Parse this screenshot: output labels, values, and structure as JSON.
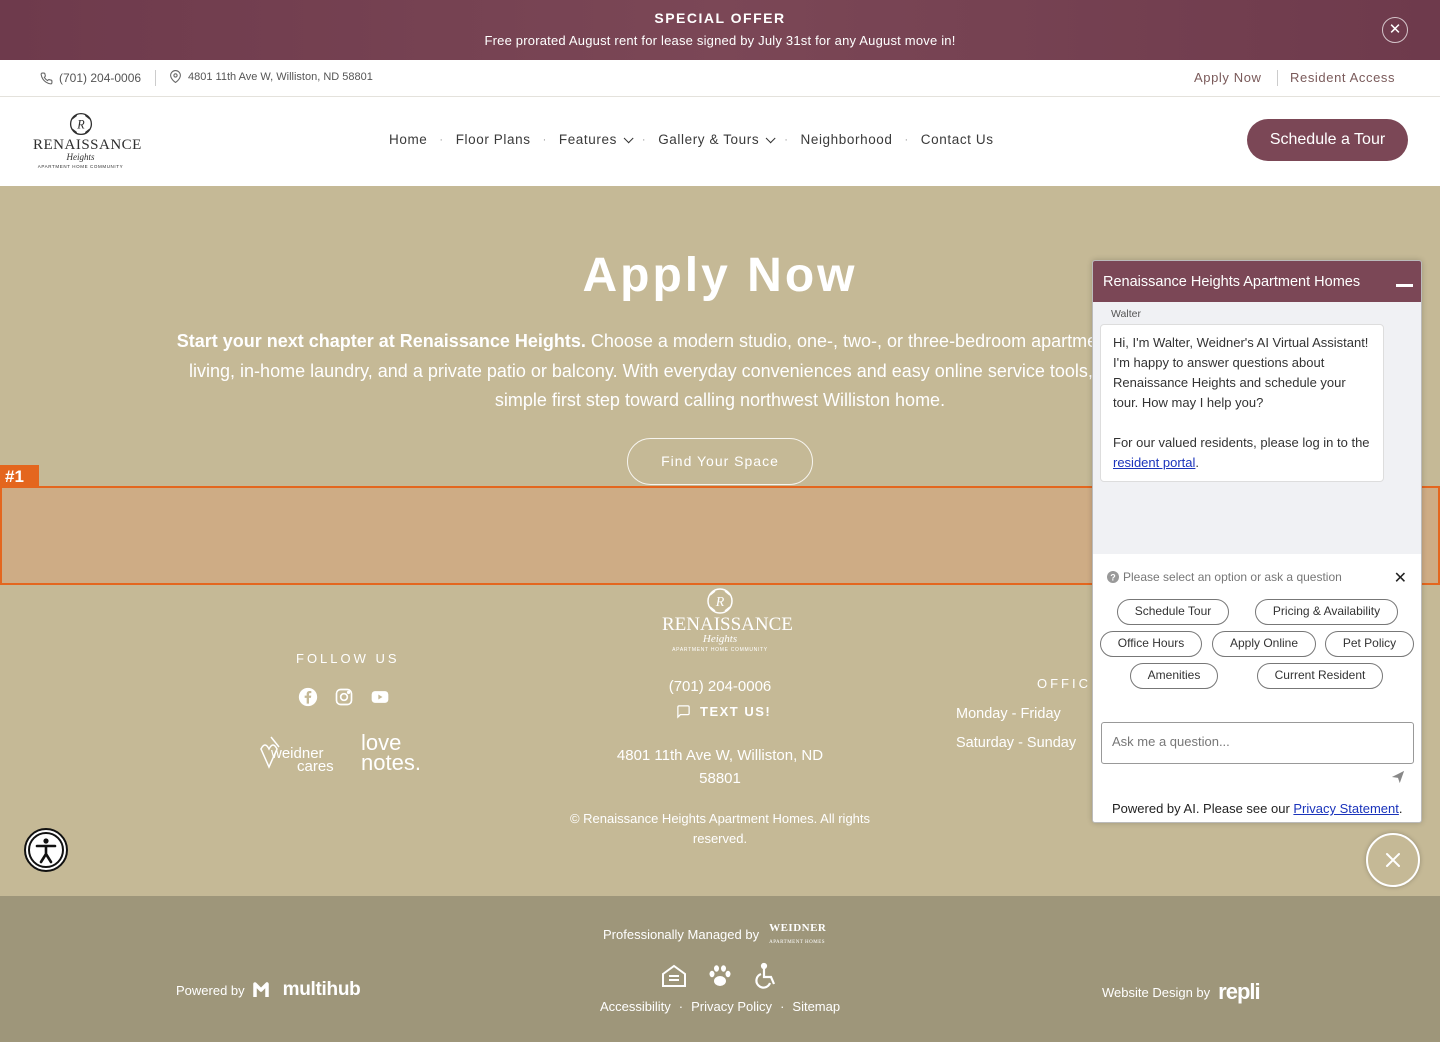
{
  "offer": {
    "title": "SPECIAL OFFER",
    "text": "Free prorated August rent for lease signed by July 31st for any August move in!",
    "close_symbol": "✕"
  },
  "util": {
    "phone": "(701) 204-0006",
    "address": "4801 11th Ave W, Williston, ND 58801",
    "apply": "Apply Now",
    "resident": "Resident Access"
  },
  "logo": {
    "name": "RENAISSANCE",
    "sub": "Heights",
    "tagline": "APARTMENT HOME COMMUNITY",
    "monogram": "R"
  },
  "nav": {
    "items": [
      "Home",
      "Floor Plans",
      "Features",
      "Gallery & Tours",
      "Neighborhood",
      "Contact Us"
    ],
    "separator": "·",
    "cta": "Schedule a Tour"
  },
  "hero": {
    "title": "Apply Now",
    "lead": "Start your next chapter at Renaissance Heights.",
    "body": " Choose a modern studio, one-, two-, or three-bedroom apartment with open-concept living, in-home laundry, and a private patio or balcony. With everyday conveniences and easy online service tools, applying now is the simple first step toward calling northwest Williston home.",
    "button": "Find Your Space"
  },
  "annotation": {
    "label": "#1"
  },
  "footer": {
    "follow": "FOLLOW US",
    "cares_1": "weidner",
    "cares_2": "cares",
    "love_1": "love",
    "love_2": "notes.",
    "phone": "(701) 204-0006",
    "text_us": "TEXT US!",
    "address": "4801 11th Ave W, Williston, ND 58801",
    "copyright": "© Renaissance Heights Apartment Homes. All rights reserved.",
    "office": "OFFICE",
    "hours_1": "Monday - Friday",
    "hours_2": "Saturday - Sunday"
  },
  "bottom": {
    "managed": "Professionally Managed by",
    "weidner": "WEIDNER",
    "weidner_sub": "APARTMENT HOMES",
    "powered": "Powered by",
    "multihub": "multihub",
    "links": [
      "Accessibility",
      "Privacy Policy",
      "Sitemap"
    ],
    "link_sep": "·",
    "design": "Website Design by",
    "repli": "repli"
  },
  "chat": {
    "title": "Renaissance Heights Apartment Homes",
    "agent": "Walter",
    "message_1": "Hi, I'm Walter, Weidner's AI Virtual Assistant! I'm happy to answer questions about Renaissance Heights and schedule your tour. How may I help you?",
    "message_2_pre": "For our valued residents, please log in to the ",
    "message_2_link": "resident portal",
    "message_2_post": ".",
    "prompt_icon": "?",
    "prompt": "Please select an option or ask a question",
    "prompt_close": "✕",
    "options": [
      "Schedule Tour",
      "Pricing & Availability",
      "Office Hours",
      "Apply Online",
      "Pet Policy",
      "Amenities",
      "Current Resident"
    ],
    "input_placeholder": "Ask me a question...",
    "powered_pre": "Powered by AI. Please see our ",
    "powered_link": "Privacy Statement",
    "powered_post": "."
  },
  "colors": {
    "brand": "#7b4756",
    "hero_bg": "#c5b996",
    "bottom_bg": "#9e967a",
    "annotation": "#e4661e"
  }
}
